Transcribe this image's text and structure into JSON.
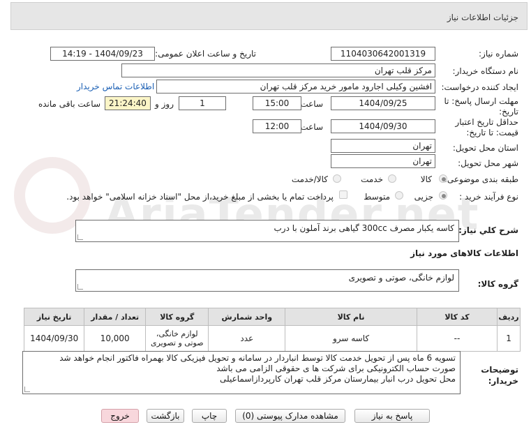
{
  "header": {
    "title": "جزئیات اطلاعات نیاز"
  },
  "watermark": {
    "text": "AriaTender.net"
  },
  "fields": {
    "need_number_label": "شماره نیاز:",
    "need_number": "1104030642001319",
    "announce_label": "تاریخ و ساعت اعلان عمومی:",
    "announce_value": "1404/09/23 - 14:19",
    "buyer_org_label": "نام دستگاه خریدار:",
    "buyer_org": "مرکز قلب تهران",
    "creator_label": "ایجاد کننده درخواست:",
    "creator": "افشین وکیلی اجارود مامور خرید مرکز قلب تهران",
    "contact_link": "اطلاعات تماس خریدار",
    "deadline_label": "مهلت ارسال پاسخ: تا تاریخ:",
    "deadline_date": "1404/09/25",
    "time_label": "ساعت",
    "deadline_time": "15:00",
    "days_value": "1",
    "days_label": "روز و",
    "remaining_time": "21:24:40",
    "remaining_label": "ساعت باقی مانده",
    "validity_label": "حداقل تاریخ اعتبار قیمت: تا تاریخ:",
    "validity_date": "1404/09/30",
    "validity_time_label": "ساعت",
    "validity_time": "12:00",
    "province_label": "استان محل تحویل:",
    "province": "تهران",
    "city_label": "شهر محل تحویل:",
    "city": "تهران",
    "category_label": "طبقه بندی موضوعی:",
    "category_options": [
      "کالا",
      "خدمت",
      "کالا/خدمت"
    ],
    "process_label": "نوع فرآیند خرید :",
    "process_options": [
      "جزیی",
      "متوسط"
    ],
    "payment_note": "پرداخت تمام یا بخشی از مبلغ خرید،از محل \"اسناد خزانه اسلامی\" خواهد بود."
  },
  "description": {
    "label": "شرح کلي نياز:",
    "value": "کاسه یکبار مصرف 300cc گیاهی برند آملون با درب"
  },
  "goods_info_title": "اطلاعات کالاهای مورد نیاز",
  "goods_group": {
    "label": "گروه کالا:",
    "value": "لوازم خانگی، صوتی و تصویری"
  },
  "table": {
    "headers": [
      "ردیف",
      "کد کالا",
      "نام کالا",
      "واحد شمارش",
      "گروه کالا",
      "تعداد / مقدار",
      "تاریخ نیاز"
    ],
    "rows": [
      [
        "1",
        "--",
        "کاسه سرو",
        "عدد",
        "لوازم خانگی، صوتی و تصویری",
        "10,000",
        "1404/09/30"
      ]
    ]
  },
  "buyer_notes": {
    "label": "توضیحات خریدار:",
    "lines": [
      "تسویه 6 ماه پس از تحویل خدمت کالا توسط انباردار در سامانه و تحویل فیزیکی کالا بهمراه فاکتور انجام خواهد شد",
      "صورت حساب الکترونیکی برای شرکت ها ی حقوقی الزامی می باشد",
      "محل تحویل درب انبار بیمارستان مرکز قلب تهران کارپردازاسماعیلی"
    ]
  },
  "buttons": {
    "reply": "پاسخ به نیاز",
    "attachments": "مشاهده مدارک پیوستی (0)",
    "print": "چاپ",
    "back": "بازگشت",
    "exit": "خروج"
  }
}
